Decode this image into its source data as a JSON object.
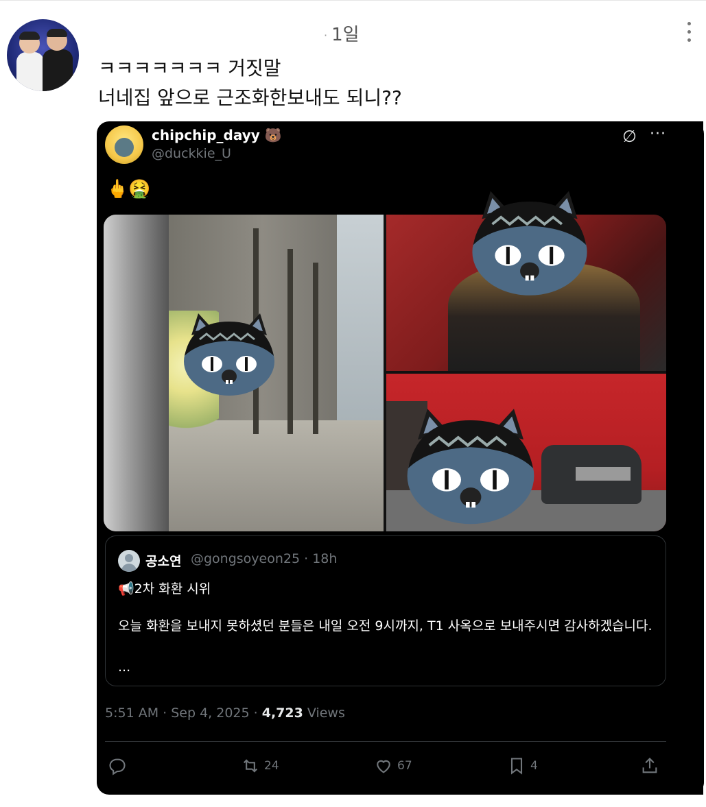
{
  "reply": {
    "time": "1일",
    "line1": "ㅋㅋㅋㅋㅋㅋㅋ 거짓말",
    "line2": "너네집 앞으로 근조화한보내도 되니??"
  },
  "quoted_tweet": {
    "display_name": "chipchip_dayy 🐻",
    "handle": "@duckkie_U",
    "emoji_text": "🖕🤮",
    "nested_quote": {
      "display_name": "공소연",
      "handle": "@gongsoyeon25 · 18h",
      "title": "📢2차 화환 시위",
      "body": "오늘 화환을 보내지 못하셨던 분들은 내일 오전 9시까지, T1 사옥으로 보내주시면 감사하겠습니다.",
      "ellipsis": "..."
    },
    "timestamp": "5:51 AM · Sep 4, 2025 · ",
    "views_count": "4,723",
    "views_label": " Views",
    "actions": {
      "reply_count": "",
      "retweet_count": "24",
      "like_count": "67",
      "bookmark_count": "4"
    }
  },
  "icons": {
    "more_vertical": "more-vertical-icon",
    "ghost": "ghost-icon",
    "more_horizontal": "more-horizontal-icon",
    "reply": "reply-icon",
    "retweet": "retweet-icon",
    "like": "heart-icon",
    "bookmark": "bookmark-icon",
    "share": "share-icon"
  },
  "colors": {
    "card_bg": "#000000",
    "muted": "#71767b",
    "text": "#e7e9ea",
    "cat_skin": "#4d6a85"
  }
}
